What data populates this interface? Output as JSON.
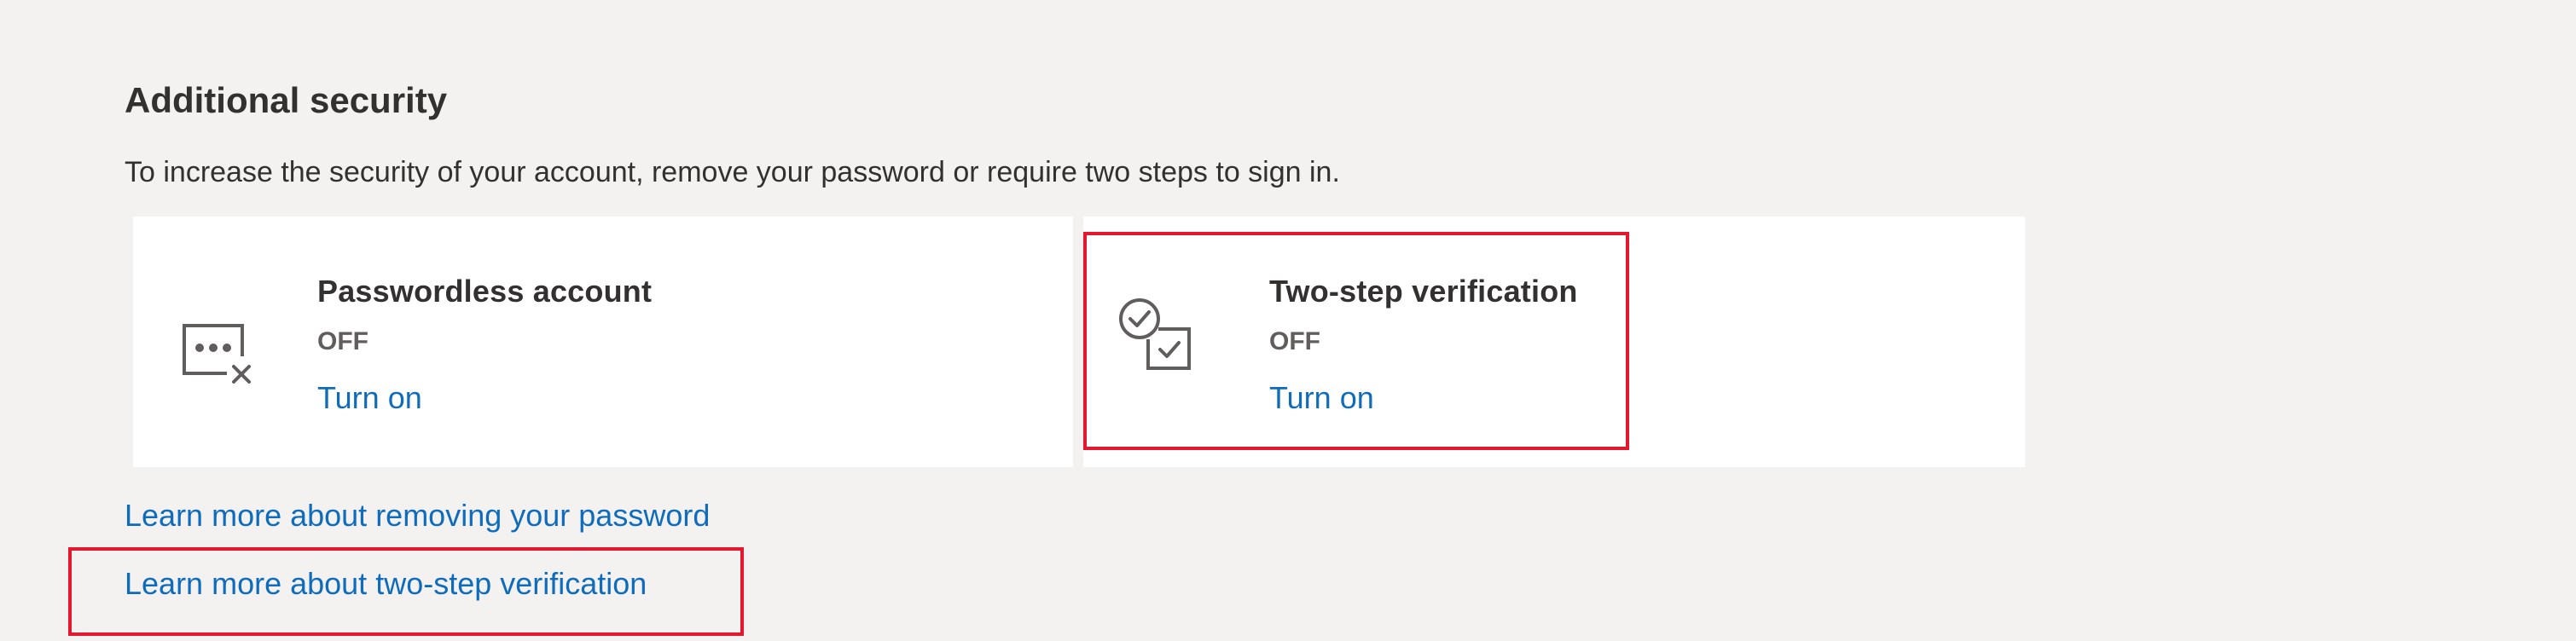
{
  "section": {
    "title": "Additional security",
    "description": "To increase the security of your account, remove your password or require two steps to sign in."
  },
  "cards": [
    {
      "title": "Passwordless account",
      "status": "OFF",
      "action_label": "Turn on",
      "icon": "password-dots-x-icon"
    },
    {
      "title": "Two-step verification",
      "status": "OFF",
      "action_label": "Turn on",
      "icon": "check-shapes-icon"
    }
  ],
  "links": {
    "remove_password": "Learn more about removing your password",
    "two_step": "Learn more about two-step verification"
  },
  "colors": {
    "background": "#f3f2f1",
    "card": "#ffffff",
    "link": "#0f6cbd",
    "highlight": "#e3172d",
    "text": "#323130",
    "status": "#605e5c"
  }
}
